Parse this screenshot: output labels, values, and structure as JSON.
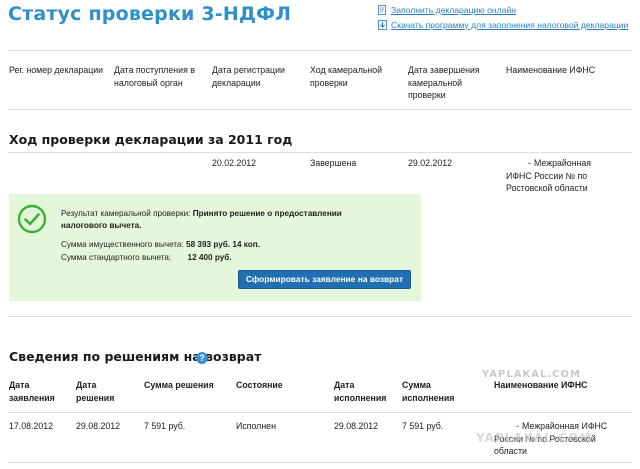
{
  "page_title": "Статус проверки 3-НДФЛ",
  "top_links": {
    "fill_online": "Заполнить декларацию онлайн",
    "download_program": "Скачать программу для заполнения налоговой декларации"
  },
  "declaration_table": {
    "headers": {
      "reg_number": "Рег. номер декларации",
      "received_date": "Дата поступления в налоговый орган",
      "registered_date": "Дата регистрации декларации",
      "check_progress": "Ход камеральной проверки",
      "check_end_date": "Дата завершения камеральной проверки",
      "ifns_name": "Наименование ИФНС"
    }
  },
  "check_section": {
    "title": "Ход проверки декларации за 2011 год",
    "row": {
      "reg_number": "",
      "received_date": "",
      "registered_date": "20.02.2012",
      "status": "Завершена",
      "end_date": "29.02.2012",
      "ifns_dash": "-",
      "ifns_name": "Межрайонная ИФНС России №     по Ростовской области"
    }
  },
  "result": {
    "label": "Результат камеральной проверки:",
    "decision": "Принято решение о предоставлении налогового вычета.",
    "property_label": "Сумма имущественного вычета:",
    "property_value": "58 393 руб. 14 коп.",
    "standard_label": "Сумма стандартного вычета:",
    "standard_value": "12 400 руб.",
    "button_label": "Сформировать заявление на возврат"
  },
  "refund_section": {
    "title": "Сведения по решениям на возврат",
    "help_label": "?",
    "headers": {
      "app_date": "Дата заявления",
      "decision_date": "Дата решения",
      "decision_amount": "Сумма решения",
      "state": "Состояние",
      "execution_date": "Дата исполнения",
      "execution_amount": "Сумма исполнения",
      "ifns_name": "Наименование ИФНС"
    },
    "rows": [
      {
        "app_date": "17.08.2012",
        "decision_date": "29.08.2012",
        "decision_amount": "7 591 руб.",
        "state": "Исполнен",
        "execution_date": "29.08.2012",
        "execution_amount": "7 591 руб.",
        "ifns_dash": "-",
        "ifns_name": "Межрайонная ИФНС России №     по Ростовской области"
      }
    ]
  },
  "watermarks": {
    "top": "YAPLAKAL.COM",
    "bottom": "YAPLAKAL.COM"
  },
  "colors": {
    "title_blue": "#2e8fc9",
    "link_blue": "#2b7fc0",
    "result_bg": "#e5f7da",
    "check_green": "#3fae3a",
    "button_blue": "#1f6fb2"
  }
}
